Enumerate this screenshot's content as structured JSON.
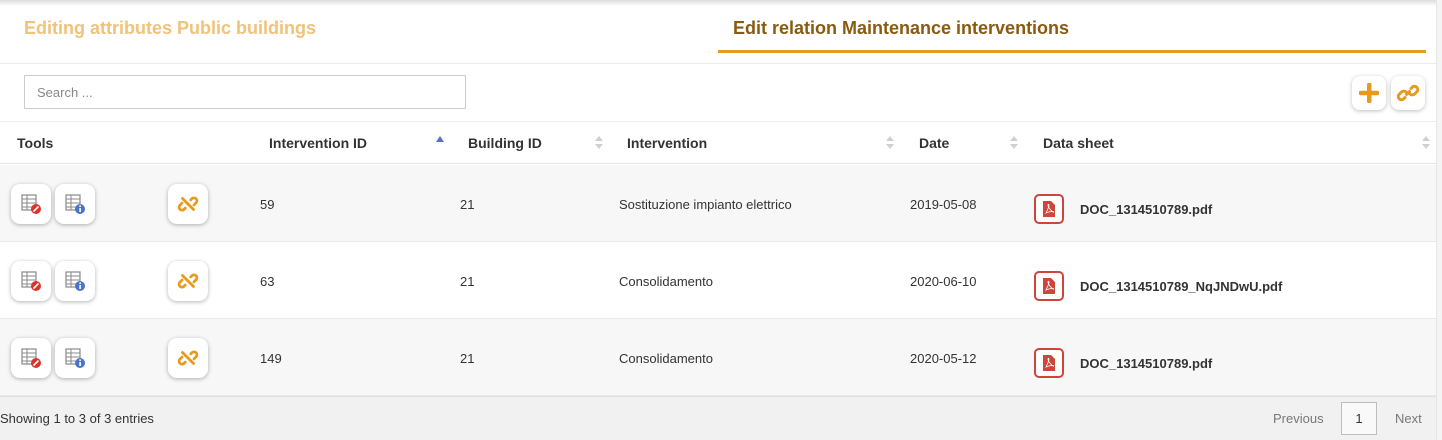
{
  "tabs": {
    "attributes_label": "Editing attributes Public buildings",
    "relation_label": "Edit relation Maintenance interventions"
  },
  "search": {
    "placeholder": "Search ..."
  },
  "toolbar": {
    "add_icon": "plus-icon",
    "link_icon": "link-icon"
  },
  "table": {
    "columns": [
      "Tools",
      "Intervention ID",
      "Building ID",
      "Intervention",
      "Date",
      "Data sheet"
    ],
    "sorted_column": "Intervention ID",
    "rows": [
      {
        "intervention_id": "59",
        "building_id": "21",
        "intervention": "Sostituzione impianto elettrico",
        "date": "2019-05-08",
        "data_sheet": "DOC_1314510789.pdf"
      },
      {
        "intervention_id": "63",
        "building_id": "21",
        "intervention": "Consolidamento",
        "date": "2020-06-10",
        "data_sheet": "DOC_1314510789_NqJNDwU.pdf"
      },
      {
        "intervention_id": "149",
        "building_id": "21",
        "intervention": "Consolidamento",
        "date": "2020-05-12",
        "data_sheet": "DOC_1314510789.pdf"
      }
    ]
  },
  "footer": {
    "info": "Showing 1 to 3 of 3 entries",
    "previous": "Previous",
    "current_page": "1",
    "next": "Next"
  },
  "colors": {
    "accent": "#e89a1c",
    "accent_dark": "#8a5a10",
    "accent_light": "#f1c27a",
    "pdf_red": "#d0453b"
  }
}
